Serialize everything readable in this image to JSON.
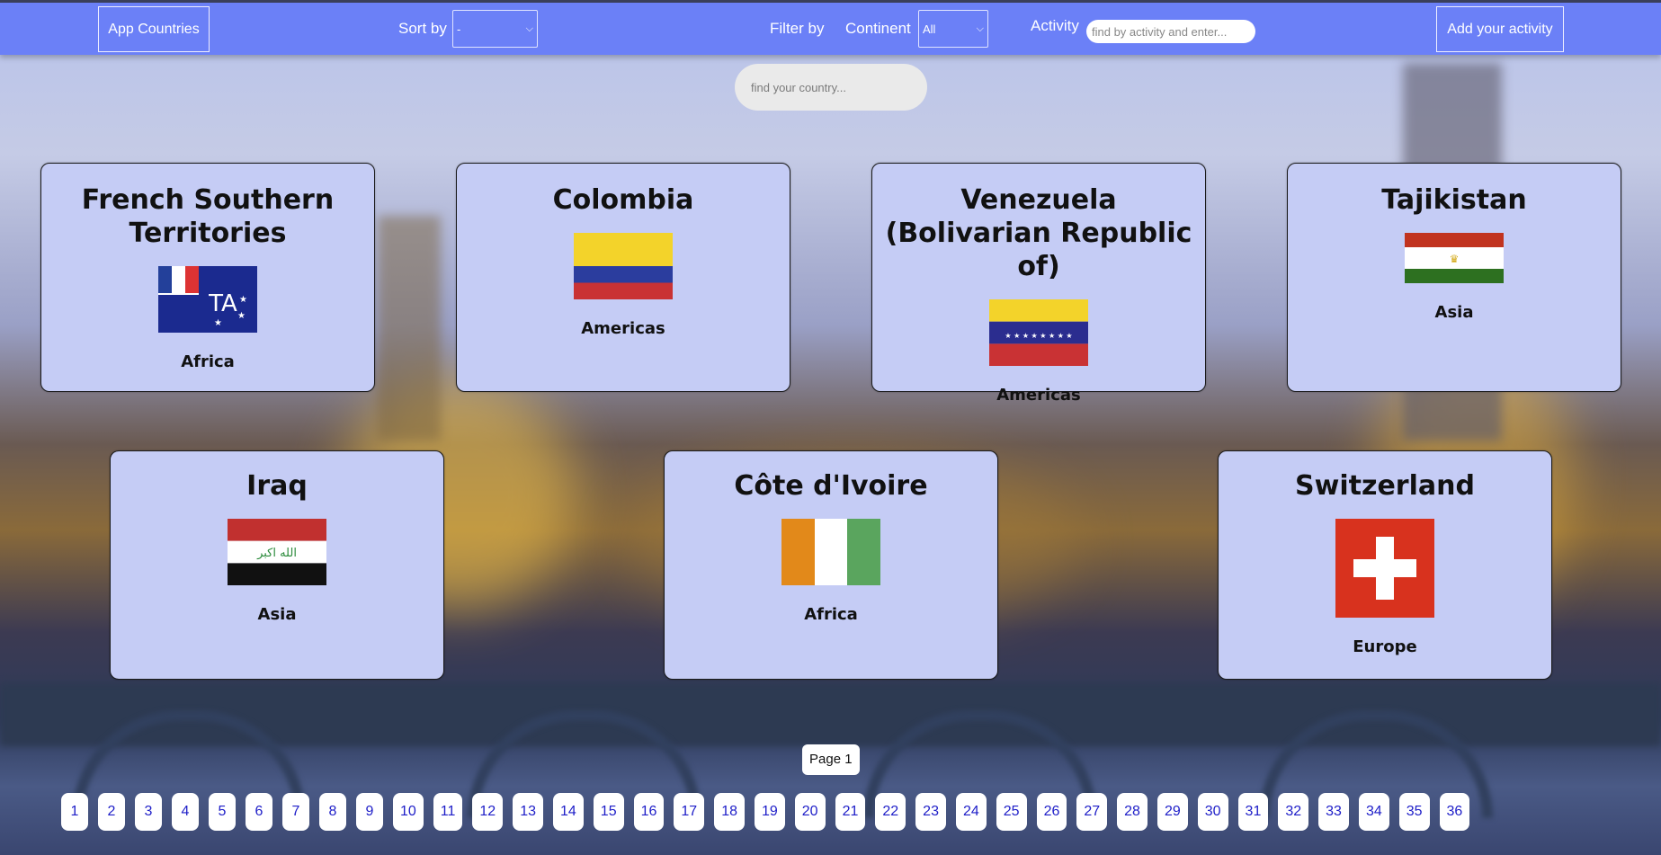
{
  "nav": {
    "app_button": "App Countries",
    "sort_label": "Sort by",
    "sort_value": "-",
    "filter_label": "Filter by",
    "continent_label": "Continent",
    "continent_value": "All",
    "activity_label": "Activity",
    "activity_placeholder": "find by activity and enter...",
    "add_activity_button": "Add your activity"
  },
  "search": {
    "placeholder": "find your country..."
  },
  "countries": [
    {
      "name": "French Southern Territories",
      "continent": "Africa",
      "flag": "french-southern-territories-flag"
    },
    {
      "name": "Colombia",
      "continent": "Americas",
      "flag": "colombia-flag"
    },
    {
      "name": "Venezuela (Bolivarian Republic of)",
      "continent": "Americas",
      "flag": "venezuela-flag"
    },
    {
      "name": "Tajikistan",
      "continent": "Asia",
      "flag": "tajikistan-flag"
    },
    {
      "name": "Iraq",
      "continent": "Asia",
      "flag": "iraq-flag"
    },
    {
      "name": "Côte d'Ivoire",
      "continent": "Africa",
      "flag": "cote-divoire-flag"
    },
    {
      "name": "Switzerland",
      "continent": "Europe",
      "flag": "switzerland-flag"
    }
  ],
  "pagination": {
    "current_label": "Page 1",
    "pages": [
      "1",
      "2",
      "3",
      "4",
      "5",
      "6",
      "7",
      "8",
      "9",
      "10",
      "11",
      "12",
      "13",
      "14",
      "15",
      "16",
      "17",
      "18",
      "19",
      "20",
      "21",
      "22",
      "23",
      "24",
      "25",
      "26",
      "27",
      "28",
      "29",
      "30",
      "31",
      "32",
      "33",
      "34",
      "35",
      "36"
    ]
  }
}
